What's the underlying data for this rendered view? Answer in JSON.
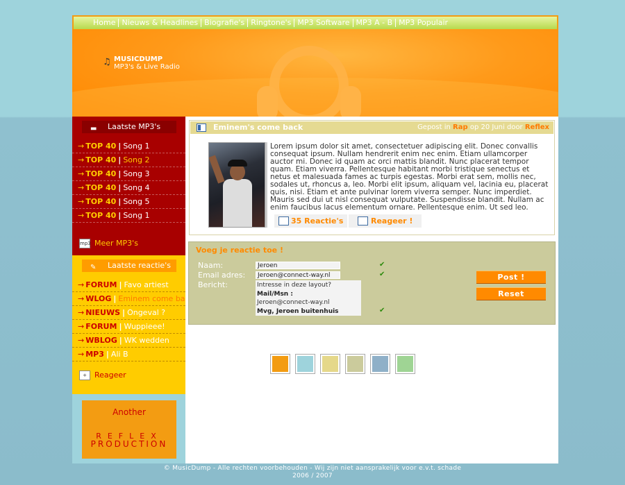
{
  "nav": [
    "Home",
    "Nieuws & Headlines",
    "Biografie's",
    "Ringtone's",
    "MP3 Software",
    "MP3 A - B",
    "MP3 Populair"
  ],
  "logo": {
    "title": "MUSICDUMP",
    "subtitle": "MP3's & Live Radio"
  },
  "sidebar": {
    "mp3_title": "Laatste MP3's",
    "mp3_items": [
      {
        "tag": "TOP 40",
        "label": "Song 1",
        "highlight": false
      },
      {
        "tag": "TOP 40",
        "label": "Song 2",
        "highlight": true
      },
      {
        "tag": "TOP 40",
        "label": "Song 3",
        "highlight": false
      },
      {
        "tag": "TOP 40",
        "label": "Song 4",
        "highlight": false
      },
      {
        "tag": "TOP 40",
        "label": "Song 5",
        "highlight": false
      },
      {
        "tag": "TOP 40",
        "label": "Song 1",
        "highlight": false
      }
    ],
    "mp3_more": "Meer MP3's",
    "reacties_title": "Laatste reactie's",
    "reacties_items": [
      {
        "tag": "FORUM",
        "label": "Favo artiest",
        "highlight": false
      },
      {
        "tag": "WLOG",
        "label": "Eminem come back",
        "highlight": true
      },
      {
        "tag": "NIEUWS",
        "label": "Ongeval ?",
        "highlight": false
      },
      {
        "tag": "FORUM",
        "label": "Wuppieee!",
        "highlight": false
      },
      {
        "tag": "WBLOG",
        "label": "WK wedden",
        "highlight": false
      },
      {
        "tag": "MP3",
        "label": "Ali B",
        "highlight": false
      }
    ],
    "reacties_more": "Reageer",
    "promo": {
      "line1": "Another",
      "line2": "REFLEX",
      "line3": "PRODUCTION"
    }
  },
  "post": {
    "title": "Eminem's come back",
    "meta_prefix": "Gepost in",
    "meta_category": "Rap",
    "meta_middle": "op 20 Juni door",
    "meta_author": "Reflex",
    "body": "Lorem ipsum dolor sit amet, consectetuer adipiscing elit. Donec convallis consequat ipsum. Nullam hendrerit enim nec enim. Etiam ullamcorper auctor mi. Donec id quam ac orci mattis blandit. Nunc placerat tempor quam. Etiam viverra. Pellentesque habitant morbi tristique senectus et netus et malesuada fames ac turpis egestas. Morbi erat sem, mollis nec, sodales ut, rhoncus a, leo. Morbi elit ipsum, aliquam vel, lacinia eu, placerat quis, nisi. Etiam et ante pulvinar lorem viverra semper. Nunc imperdiet. Mauris sed dui ut nisl consequat vulputate. Suspendisse blandit. Nullam ac enim faucibus lacus elementum ornare. Pellentesque enim. Ut sed leo.",
    "reactions_label": "35 Reactie's",
    "reply_label": "Reageer !"
  },
  "form": {
    "title": "Voeg je reactie toe !",
    "name_label": "Naam:",
    "name_value": "Jeroen",
    "email_label": "Email adres:",
    "email_value": "Jeroen@connect-way.nl",
    "message_label": "Bericht:",
    "message_line1": "Intresse in deze layout?",
    "message_line2": "Mail/Msn :",
    "message_line3": "Jeroen@connect-way.nl",
    "message_line4": "Mvg, Jeroen buitenhuis",
    "post_button": "Post !",
    "reset_button": "Reset"
  },
  "swatches": [
    "#f39c12",
    "#9ed3dc",
    "#e5d88a",
    "#cbcb9c",
    "#8fb0c8",
    "#9fd494"
  ],
  "footer": {
    "line1": "© MusicDump - Alle rechten voorbehouden - Wij zijn niet aansprakelijk voor e.v.t. schade",
    "line2": "2006 / 2007"
  }
}
